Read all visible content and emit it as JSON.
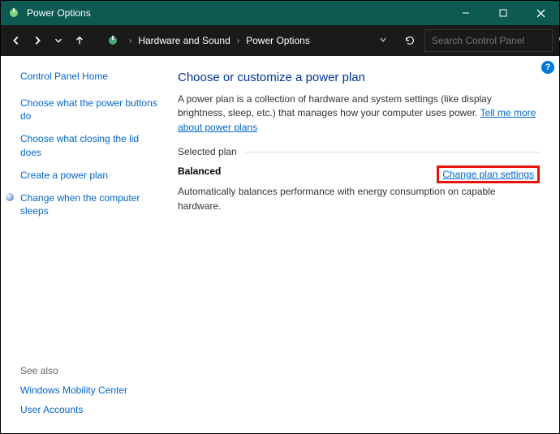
{
  "window": {
    "title": "Power Options"
  },
  "breadcrumb": {
    "item1": "Hardware and Sound",
    "item2": "Power Options"
  },
  "search": {
    "placeholder": "Search Control Panel"
  },
  "sidebar": {
    "home": "Control Panel Home",
    "links": {
      "l0": "Choose what the power buttons do",
      "l1": "Choose what closing the lid does",
      "l2": "Create a power plan",
      "l3": "Change when the computer sleeps"
    },
    "seealso_h": "See also",
    "seealso": {
      "s0": "Windows Mobility Center",
      "s1": "User Accounts"
    }
  },
  "main": {
    "heading": "Choose or customize a power plan",
    "desc_pre": "A power plan is a collection of hardware and system settings (like display brightness, sleep, etc.) that manages how your computer uses power. ",
    "desc_link": "Tell me more about power plans",
    "section_label": "Selected plan",
    "plan": {
      "name": "Balanced",
      "change": "Change plan settings",
      "desc": "Automatically balances performance with energy consumption on capable hardware."
    }
  }
}
